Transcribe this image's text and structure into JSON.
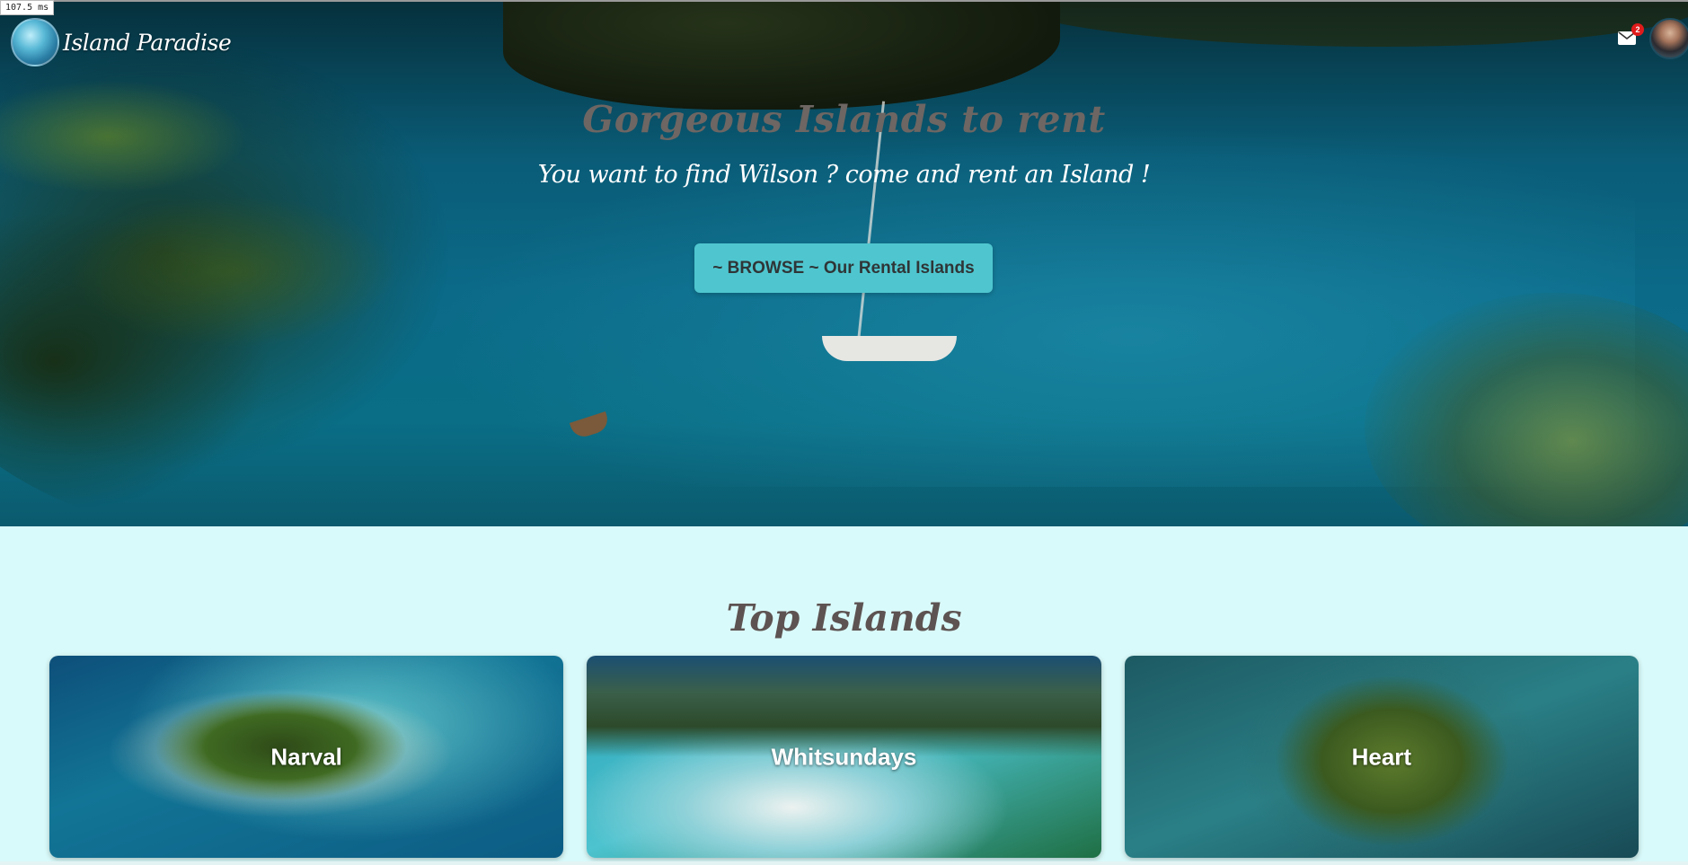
{
  "perf_badge": "107.5 ms",
  "header": {
    "brand": "Island Paradise",
    "mail_badge_count": "2"
  },
  "hero": {
    "title": "Gorgeous Islands to rent",
    "subtitle": "You want to find Wilson ? come and rent an Island !",
    "browse_button": "~ BROWSE ~ Our Rental Islands"
  },
  "top_islands": {
    "title": "Top Islands",
    "cards": [
      {
        "label": "Narval"
      },
      {
        "label": "Whitsundays"
      },
      {
        "label": "Heart"
      }
    ]
  },
  "colors": {
    "button_bg": "#4fc6cf",
    "section_bg": "#d9fafa",
    "title_color": "#5d5352",
    "badge_red": "#e01b1b"
  },
  "icons": {
    "mail": "mail-icon",
    "avatar": "user-avatar"
  }
}
